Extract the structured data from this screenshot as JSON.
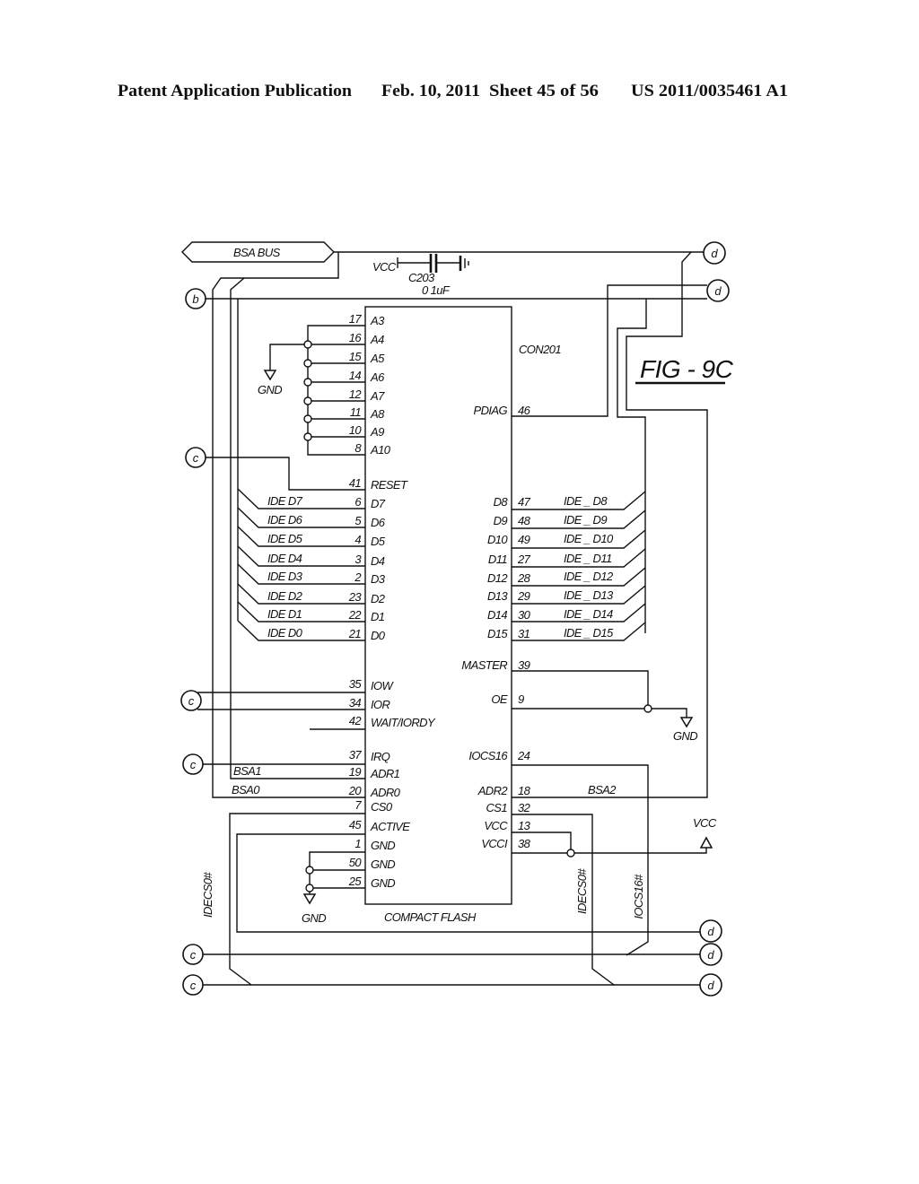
{
  "header": {
    "publication": "Patent Application Publication",
    "date": "Feb. 10, 2011",
    "sheet": "Sheet 45 of 56",
    "patent_number": "US 2011/0035461 A1"
  },
  "figure": {
    "label": "FIG - 9C",
    "component": "CON201",
    "device": "COMPACT FLASH"
  },
  "bus": {
    "label": "BSA BUS"
  },
  "capacitor": {
    "supply": "VCC",
    "ref": "C203",
    "value": "0 1uF"
  },
  "connectors": {
    "b": "b",
    "c": "c",
    "d": "d"
  },
  "power": {
    "gnd": "GND",
    "vcc": "VCC"
  },
  "left_pins": [
    {
      "num": "17",
      "name": "A3"
    },
    {
      "num": "16",
      "name": "A4"
    },
    {
      "num": "15",
      "name": "A5"
    },
    {
      "num": "14",
      "name": "A6"
    },
    {
      "num": "12",
      "name": "A7"
    },
    {
      "num": "11",
      "name": "A8"
    },
    {
      "num": "10",
      "name": "A9"
    },
    {
      "num": "8",
      "name": "A10"
    },
    {
      "num": "41",
      "name": "RESET"
    },
    {
      "num": "6",
      "name": "D7"
    },
    {
      "num": "5",
      "name": "D6"
    },
    {
      "num": "4",
      "name": "D5"
    },
    {
      "num": "3",
      "name": "D4"
    },
    {
      "num": "2",
      "name": "D3"
    },
    {
      "num": "23",
      "name": "D2"
    },
    {
      "num": "22",
      "name": "D1"
    },
    {
      "num": "21",
      "name": "D0"
    },
    {
      "num": "35",
      "name": "IOW"
    },
    {
      "num": "34",
      "name": "IOR"
    },
    {
      "num": "42",
      "name": "WAIT/IORDY"
    },
    {
      "num": "37",
      "name": "IRQ"
    },
    {
      "num": "19",
      "name": "ADR1"
    },
    {
      "num": "20",
      "name": "ADR0"
    },
    {
      "num": "7",
      "name": "CS0"
    },
    {
      "num": "45",
      "name": "ACTIVE"
    },
    {
      "num": "1",
      "name": "GND"
    },
    {
      "num": "50",
      "name": "GND"
    },
    {
      "num": "25",
      "name": "GND"
    }
  ],
  "right_pins": [
    {
      "num": "46",
      "name": "PDIAG"
    },
    {
      "num": "47",
      "name": "D8"
    },
    {
      "num": "48",
      "name": "D9"
    },
    {
      "num": "49",
      "name": "D10"
    },
    {
      "num": "27",
      "name": "D11"
    },
    {
      "num": "28",
      "name": "D12"
    },
    {
      "num": "29",
      "name": "D13"
    },
    {
      "num": "30",
      "name": "D14"
    },
    {
      "num": "31",
      "name": "D15"
    },
    {
      "num": "39",
      "name": "MASTER"
    },
    {
      "num": "9",
      "name": "OE"
    },
    {
      "num": "24",
      "name": "IOCS16"
    },
    {
      "num": "18",
      "name": "ADR2"
    },
    {
      "num": "32",
      "name": "CS1"
    },
    {
      "num": "13",
      "name": "VCC"
    },
    {
      "num": "38",
      "name": "VCCI"
    }
  ],
  "net_labels": {
    "ide_left": [
      "IDE D7",
      "IDE D6",
      "IDE D5",
      "IDE D4",
      "IDE D3",
      "IDE D2",
      "IDE D1",
      "IDE D0"
    ],
    "ide_right": [
      "IDE _ D8",
      "IDE _ D9",
      "IDE _ D10",
      "IDE _ D11",
      "IDE _ D12",
      "IDE _ D13",
      "IDE _ D14",
      "IDE _ D15"
    ],
    "bsa1": "BSA1",
    "bsa0": "BSA0",
    "bsa2": "BSA2",
    "idecs0_left": "IDECS0#",
    "idecs0_right": "IDECS0#",
    "iocs16": "IOCS16#"
  }
}
